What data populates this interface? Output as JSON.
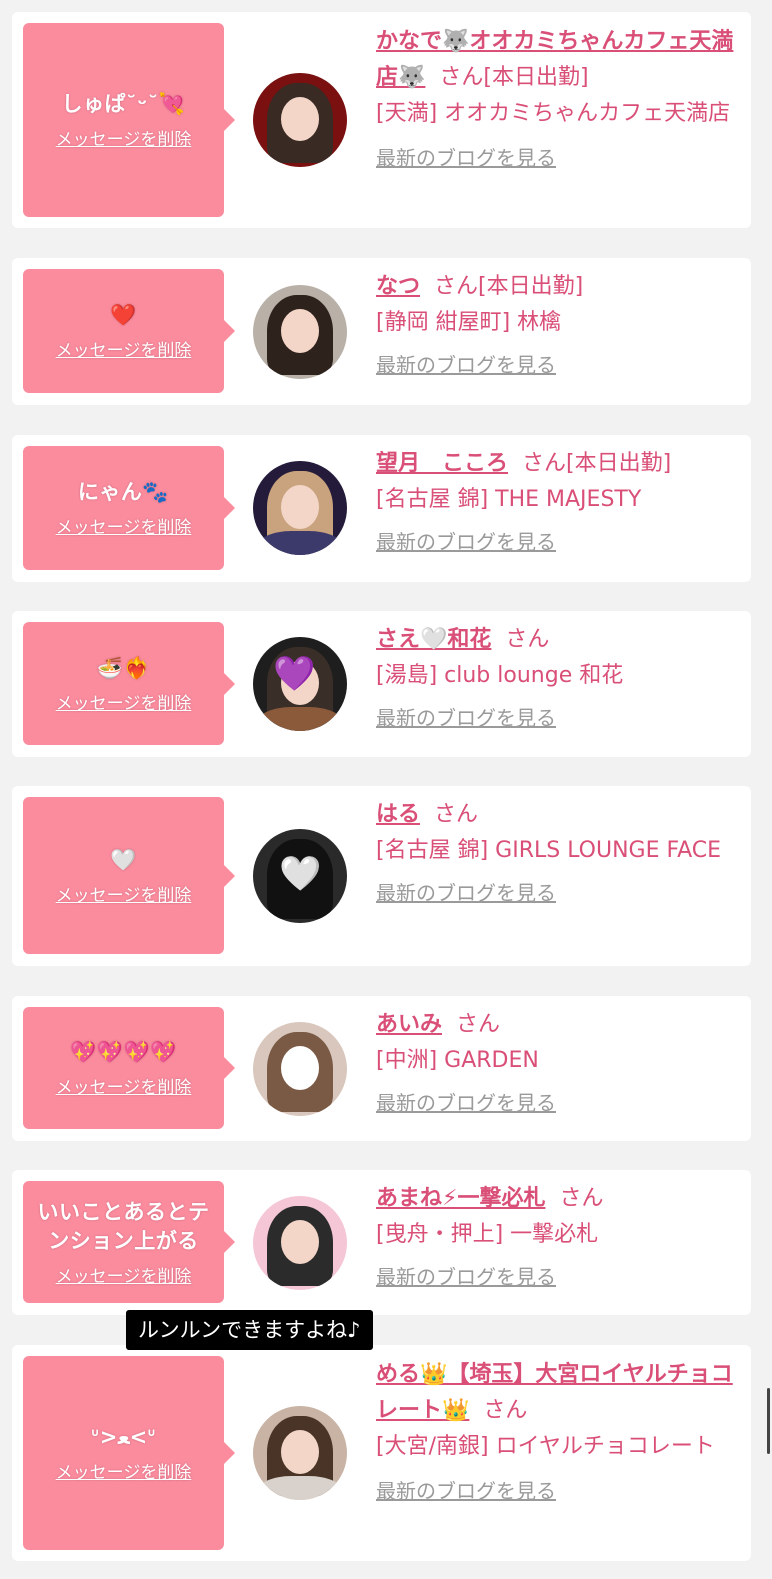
{
  "delete_label": "メッセージを削除",
  "blog_label": "最新のブログを見る",
  "san_label": "さん",
  "tooltip": "ルンルンできますよね♪",
  "accent_color": "#fa8c9e",
  "text_color": "#d94f77",
  "cards": [
    {
      "message": "しゅぱ˘ᵕ˘💘",
      "name": "かなで🐺オオカミちゃんカフェ天満店🐺",
      "status": "[本日出勤]",
      "shop": "[天満] オオカミちゃんカフェ天満店"
    },
    {
      "message": "❤️",
      "name": "なつ",
      "status": "[本日出勤]",
      "shop": "[静岡 紺屋町] 林檎"
    },
    {
      "message": "にゃん🐾",
      "name": "望月　こころ",
      "status": "[本日出勤]",
      "shop": "[名古屋 錦] THE MAJESTY"
    },
    {
      "message": "🍜❤️‍🔥",
      "name": "さえ🤍和花",
      "status": "",
      "shop": "[湯島] club lounge 和花"
    },
    {
      "message": "🤍",
      "name": "はる",
      "status": "",
      "shop": "[名古屋 錦] GIRLS LOUNGE FACE"
    },
    {
      "message": "💖💖💖💖",
      "name": "あいみ",
      "status": "",
      "shop": "[中洲] GARDEN"
    },
    {
      "message": "いいことあるとテンション上がる",
      "name": "あまね⚡一撃必札",
      "status": "",
      "shop": "[曳舟・押上] 一撃必札"
    },
    {
      "message": "ᐡ>ﻌ<ᐡ",
      "name": "める👑【埼玉】大宮ロイヤルチョコレート👑",
      "status": "",
      "shop": "[大宮/南銀] ロイヤルチョコレート"
    }
  ]
}
